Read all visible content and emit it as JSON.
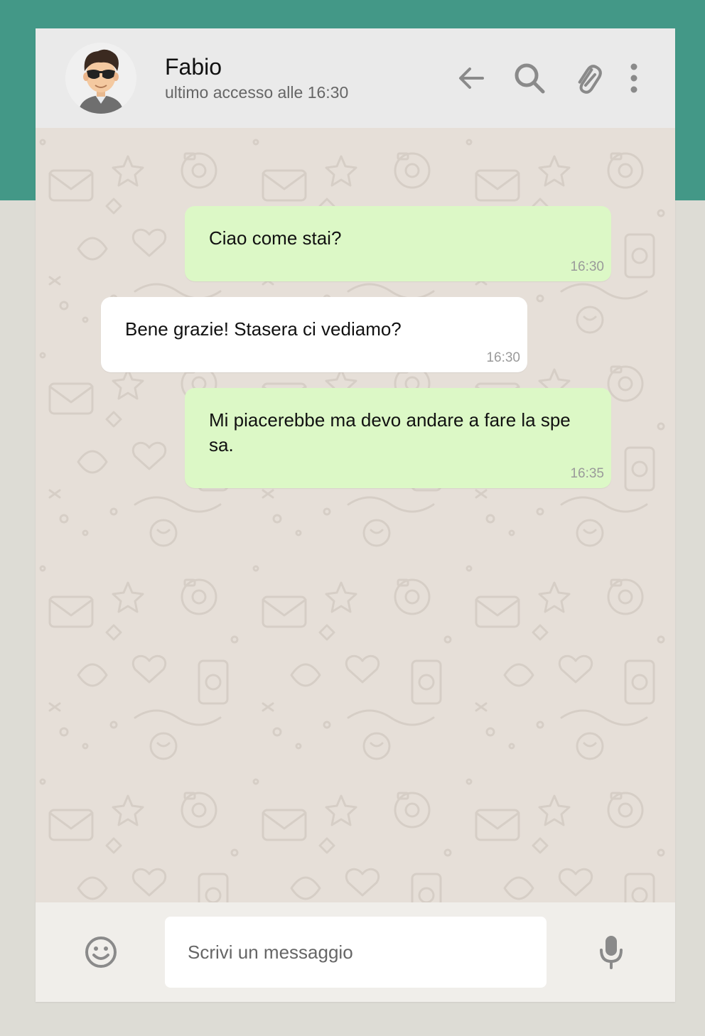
{
  "header": {
    "contact_name": "Fabio",
    "last_seen": "ultimo accesso alle 16:30",
    "avatar_icon": "avatar-sunglasses-man",
    "actions": [
      "back-arrow-icon",
      "search-icon",
      "attach-icon",
      "more-vertical-icon"
    ]
  },
  "messages": [
    {
      "direction": "outgoing",
      "text": "Ciao come stai?",
      "time": "16:30"
    },
    {
      "direction": "incoming",
      "text": "Bene grazie! Stasera ci vediamo?",
      "time": "16:30"
    },
    {
      "direction": "outgoing",
      "text": "Mi piacerebbe ma devo andare a fare la spe sa.",
      "time": "16:35"
    }
  ],
  "composer": {
    "placeholder": "Scrivi un messaggio",
    "value": "",
    "emoji_icon": "smiley-icon",
    "mic_icon": "microphone-icon"
  },
  "colors": {
    "brand_teal": "#439887",
    "header_bg": "#eaeaea",
    "chat_bg": "#e6dfd8",
    "outgoing_bubble": "#dcf8c6",
    "incoming_bubble": "#ffffff",
    "icon_gray": "#8a8a8a"
  }
}
